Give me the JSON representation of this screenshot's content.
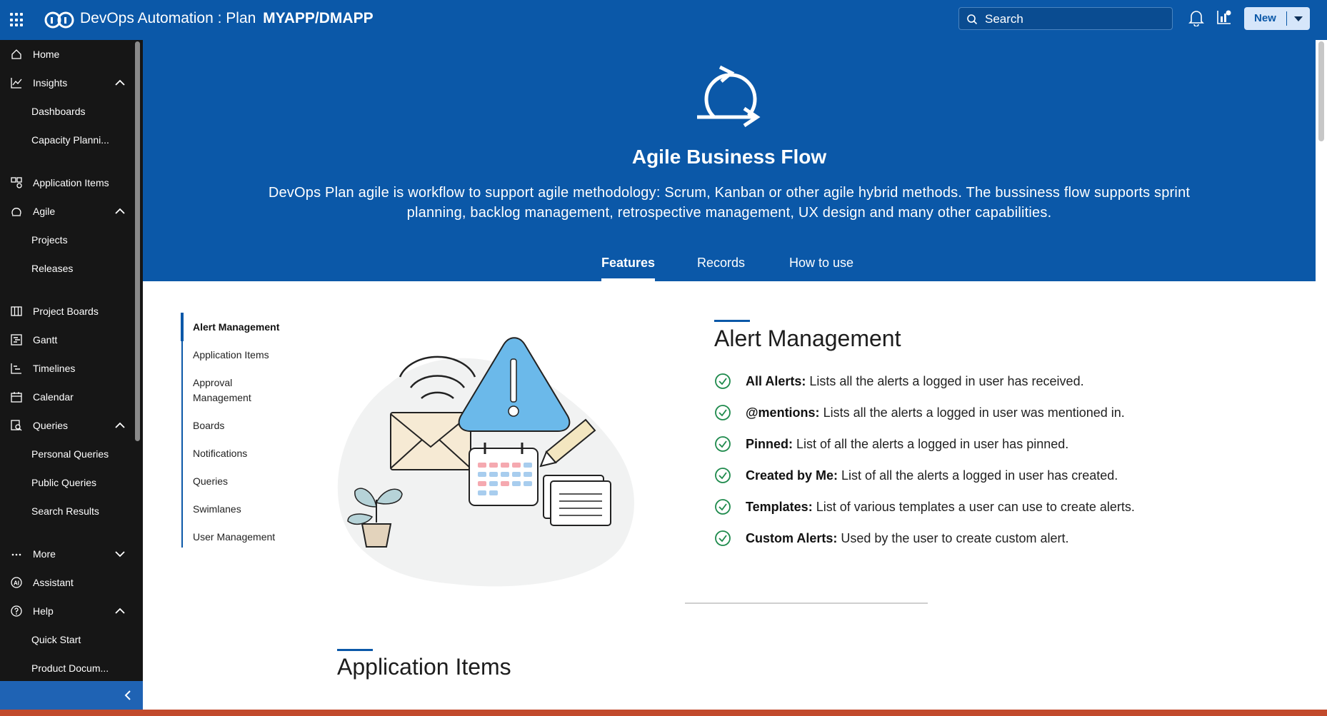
{
  "header": {
    "app_name": "DevOps Automation : Plan",
    "project": "MYAPP/DMAPP",
    "search_placeholder": "Search",
    "new_label": "New",
    "icons": [
      "apps-grid-icon",
      "devops-logo-icon",
      "search-icon",
      "notification-bell-icon",
      "analytics-icon",
      "caret-down-icon"
    ]
  },
  "sidebar": {
    "items": [
      {
        "label": "Home",
        "icon": "home-icon"
      },
      {
        "label": "Insights",
        "icon": "insights-icon",
        "expanded": true
      },
      {
        "label": "Dashboards"
      },
      {
        "label": "Capacity Planni..."
      },
      {
        "label": "Application Items",
        "icon": "application-items-icon"
      },
      {
        "label": "Agile",
        "icon": "agile-icon",
        "expanded": true
      },
      {
        "label": "Projects"
      },
      {
        "label": "Releases"
      },
      {
        "label": "Project Boards",
        "icon": "boards-icon"
      },
      {
        "label": "Gantt",
        "icon": "gantt-icon"
      },
      {
        "label": "Timelines",
        "icon": "timelines-icon"
      },
      {
        "label": "Calendar",
        "icon": "calendar-icon"
      },
      {
        "label": "Queries",
        "icon": "queries-icon",
        "expanded": true
      },
      {
        "label": "Personal Queries"
      },
      {
        "label": "Public Queries"
      },
      {
        "label": "Search Results"
      },
      {
        "label": "More",
        "icon": "more-icon",
        "expanded": false
      },
      {
        "label": "Assistant",
        "icon": "assistant-icon"
      },
      {
        "label": "Help",
        "icon": "help-icon",
        "expanded": true
      },
      {
        "label": "Quick Start"
      },
      {
        "label": "Product Docum..."
      }
    ],
    "collapse_icon": "chevron-left-icon"
  },
  "hero": {
    "icon": "cycle-arrow-icon",
    "title": "Agile Business Flow",
    "description": "DevOps Plan agile is workflow to support agile methodology: Scrum, Kanban or other agile hybrid methods. The bussiness flow supports sprint planning, backlog management, retrospective management, UX design and many other capabilities.",
    "tabs": [
      "Features",
      "Records",
      "How to use"
    ],
    "active_tab": "Features"
  },
  "feature_nav": {
    "items": [
      "Alert Management",
      "Application Items",
      "Approval Management",
      "Boards",
      "Notifications",
      "Queries",
      "Swimlanes",
      "User Management"
    ],
    "active": "Alert Management"
  },
  "sections": [
    {
      "title": "Alert Management",
      "features": [
        {
          "term": "All Alerts:",
          "desc": " Lists all the alerts a logged in user has received."
        },
        {
          "term": "@mentions:",
          "desc": " Lists all the alerts a logged in user was mentioned in."
        },
        {
          "term": "Pinned:",
          "desc": " List of all the alerts a logged in user has pinned."
        },
        {
          "term": "Created by Me:",
          "desc": " List of all the alerts a logged in user has created."
        },
        {
          "term": "Templates:",
          "desc": " List of various templates a user can use to create alerts."
        },
        {
          "term": "Custom Alerts:",
          "desc": " Used by the user to create custom alert."
        }
      ]
    },
    {
      "title": "Application Items"
    }
  ],
  "colors": {
    "primary": "#0b58a8",
    "sidebar_bg": "#161616",
    "check_green": "#1e8a4c"
  }
}
